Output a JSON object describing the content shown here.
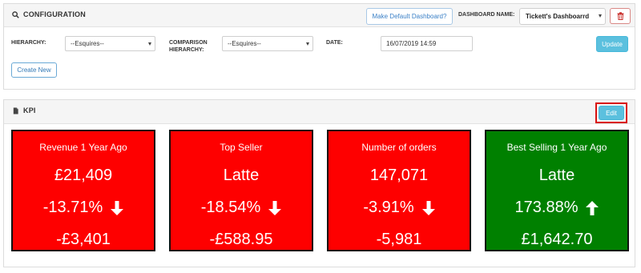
{
  "config": {
    "title": "CONFIGURATION",
    "make_default_label": "Make Default Dashboard?",
    "dashboard_name_label": "DASHBOARD NAME:",
    "dashboard_name_value": "Tickett's Dashboarrd",
    "hierarchy_label": "HIERARCHY:",
    "hierarchy_value": "--Esquires--",
    "comparison_label_line1": "COMPARISON",
    "comparison_label_line2": "HIERARCHY:",
    "comparison_value": "--Esquires--",
    "date_label": "DATE:",
    "date_value": "16/07/2019 14:59",
    "update_label": "Update",
    "create_new_label": "Create New"
  },
  "kpi": {
    "title": "KPI",
    "edit_label": "Edit",
    "cards": [
      {
        "title": "Revenue 1 Year Ago",
        "value": "£21,409",
        "change": "-13.71%",
        "direction": "down",
        "diff": "-£3,401",
        "color": "#fe0000"
      },
      {
        "title": "Top Seller",
        "value": "Latte",
        "change": "-18.54%",
        "direction": "down",
        "diff": "-£588.95",
        "color": "#fe0000"
      },
      {
        "title": "Number of orders",
        "value": "147,071",
        "change": "-3.91%",
        "direction": "down",
        "diff": "-5,981",
        "color": "#fe0000"
      },
      {
        "title": "Best Selling 1 Year Ago",
        "value": "Latte",
        "change": "173.88%",
        "direction": "up",
        "diff": "£1,642.70",
        "color": "#008000"
      }
    ]
  },
  "icons": {
    "config": "search-icon",
    "delete": "trash-icon",
    "kpi": "document-icon",
    "down": "arrow-down-icon",
    "up": "arrow-up-icon"
  }
}
